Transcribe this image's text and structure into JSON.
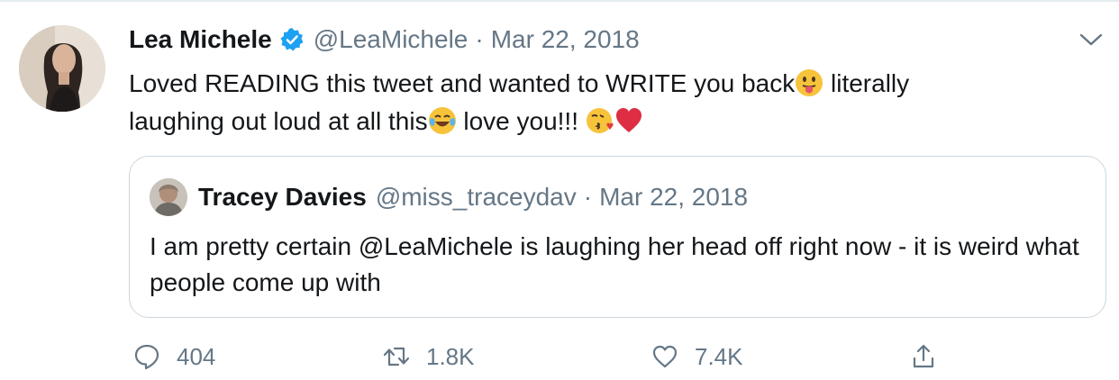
{
  "tweet": {
    "author": {
      "name": "Lea Michele",
      "handle": "@LeaMichele",
      "verified": true
    },
    "separator": "·",
    "date": "Mar 22, 2018",
    "text": {
      "line1_part1": "Loved READING this tweet and wanted to WRITE you back",
      "line1_part2": " literally",
      "line2_part1": "laughing out loud at all this",
      "line2_part2": " love you!!! "
    },
    "emojis": [
      "face-with-tongue-icon",
      "tears-of-joy-icon",
      "face-blowing-kiss-icon",
      "red-heart-icon"
    ],
    "quoted": {
      "author": {
        "name": "Tracey Davies",
        "handle": "@miss_traceydav"
      },
      "date": "Mar 22, 2018",
      "text": "I am pretty certain @LeaMichele is laughing her head off right now - it is weird what people come up with"
    },
    "actions": {
      "replies": "404",
      "retweets": "1.8K",
      "likes": "7.4K"
    }
  },
  "colors": {
    "text": "#14171a",
    "secondary": "#657786",
    "verified": "#1da1f2",
    "border": "#ccd6dd"
  }
}
